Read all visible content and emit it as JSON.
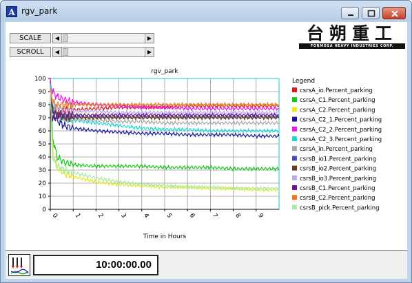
{
  "window": {
    "title": "rgv_park",
    "app_icon": "A"
  },
  "controls": {
    "scale_label": "SCALE",
    "scroll_label": "SCROLL"
  },
  "logo": {
    "chinese": "台朔重工",
    "english": "FORMOSA HEAVY INDUSTRIES CORP."
  },
  "status": {
    "time": "10:00:00.00",
    "icon": "recorder-pens-icon"
  },
  "chart_data": {
    "type": "line",
    "title": "rgv_park",
    "xlabel": "Time in Hours",
    "ylabel": "",
    "xlim": [
      0,
      10
    ],
    "ylim": [
      0,
      100
    ],
    "x_ticks": [
      "0",
      "1",
      "2",
      "3",
      "4",
      "5",
      "6",
      "7",
      "8",
      "9"
    ],
    "y_ticks": [
      "0",
      "10",
      "20",
      "30",
      "40",
      "50",
      "60",
      "70",
      "80",
      "90",
      "100"
    ],
    "grid": true,
    "legend_title": "Legend",
    "legend_position": "right",
    "series": [
      {
        "name": "csrsA_io.Percent_parking",
        "color": "#e01818",
        "x": [
          0,
          0.1,
          0.3,
          0.6,
          1,
          2,
          3,
          4,
          5,
          6,
          7,
          8,
          9,
          10
        ],
        "y": [
          92,
          80,
          74,
          76,
          76,
          77,
          78,
          78,
          78,
          79,
          79,
          79,
          79,
          79
        ]
      },
      {
        "name": "csrsA_C1.Percent_parking",
        "color": "#18c818",
        "x": [
          0,
          0.1,
          0.3,
          0.6,
          1,
          2,
          3,
          4,
          5,
          6,
          7,
          8,
          9,
          10
        ],
        "y": [
          95,
          55,
          40,
          36,
          34,
          33,
          33,
          33,
          32,
          32,
          32,
          31,
          31,
          31
        ]
      },
      {
        "name": "csrsA_C2.Percent_parking",
        "color": "#e8e818",
        "x": [
          0,
          0.1,
          0.3,
          0.6,
          1,
          2,
          3,
          4,
          5,
          6,
          7,
          8,
          9,
          10
        ],
        "y": [
          90,
          45,
          32,
          28,
          25,
          21,
          19,
          18,
          17,
          17,
          16,
          16,
          15,
          15
        ]
      },
      {
        "name": "csrsA_C2_1.Percent_parking",
        "color": "#1a1a9a",
        "x": [
          0,
          0.1,
          0.3,
          0.6,
          1,
          2,
          3,
          4,
          5,
          6,
          7,
          8,
          9,
          10
        ],
        "y": [
          90,
          75,
          68,
          64,
          62,
          60,
          59,
          58,
          58,
          57,
          57,
          57,
          56,
          56
        ]
      },
      {
        "name": "csrsA_C2_2.Percent_parking",
        "color": "#e818e8",
        "x": [
          0,
          0.1,
          0.3,
          0.6,
          1,
          2,
          3,
          4,
          5,
          6,
          7,
          8,
          9,
          10
        ],
        "y": [
          98,
          90,
          86,
          84,
          82,
          80,
          79,
          78,
          78,
          77,
          77,
          77,
          77,
          77
        ]
      },
      {
        "name": "csrsA_C2_3.Percent_parking",
        "color": "#18d8d8",
        "x": [
          0,
          0.1,
          0.3,
          0.6,
          1,
          2,
          3,
          4,
          5,
          6,
          7,
          8,
          9,
          10
        ],
        "y": [
          95,
          80,
          72,
          70,
          68,
          66,
          64,
          62,
          61,
          61,
          60,
          60,
          60,
          60
        ]
      },
      {
        "name": "csrsA_in.Percent_parking",
        "color": "#a8a8a8",
        "x": [
          0,
          0.1,
          0.3,
          0.6,
          1,
          2,
          3,
          4,
          5,
          6,
          7,
          8,
          9,
          10
        ],
        "y": [
          90,
          78,
          72,
          70,
          69,
          68,
          67,
          67,
          66,
          66,
          66,
          66,
          66,
          66
        ]
      },
      {
        "name": "csrsB_io1.Percent_parking",
        "color": "#4848b8",
        "x": [
          0,
          0.1,
          0.3,
          0.6,
          1,
          2,
          3,
          4,
          5,
          6,
          7,
          8,
          9,
          10
        ],
        "y": [
          85,
          75,
          72,
          71,
          71,
          71,
          71,
          71,
          71,
          71,
          71,
          71,
          71,
          71
        ]
      },
      {
        "name": "csrsB_io2.Percent_parking",
        "color": "#6b3a1a",
        "x": [
          0,
          0.1,
          0.3,
          0.6,
          1,
          2,
          3,
          4,
          5,
          6,
          7,
          8,
          9,
          10
        ],
        "y": [
          88,
          76,
          72,
          70,
          70,
          70,
          70,
          70,
          70,
          70,
          70,
          70,
          70,
          70
        ]
      },
      {
        "name": "csrsB_io3.Percent_parking",
        "color": "#b8a8e8",
        "x": [
          0,
          0.1,
          0.3,
          0.6,
          1,
          2,
          3,
          4,
          5,
          6,
          7,
          8,
          9,
          10
        ],
        "y": [
          92,
          82,
          78,
          76,
          75,
          75,
          74,
          74,
          74,
          74,
          74,
          74,
          74,
          74
        ]
      },
      {
        "name": "csrsB_C1.Percent_parking",
        "color": "#6a1a8a",
        "x": [
          0,
          0.1,
          0.3,
          0.6,
          1,
          2,
          3,
          4,
          5,
          6,
          7,
          8,
          9,
          10
        ],
        "y": [
          85,
          68,
          72,
          72,
          72,
          72,
          72,
          72,
          72,
          72,
          72,
          72,
          72,
          72
        ]
      },
      {
        "name": "csrsB_C2.Percent_parking",
        "color": "#e87818",
        "x": [
          0,
          0.1,
          0.3,
          0.6,
          1,
          2,
          3,
          4,
          5,
          6,
          7,
          8,
          9,
          10
        ],
        "y": [
          92,
          82,
          80,
          80,
          80,
          80,
          80,
          80,
          80,
          80,
          80,
          80,
          80,
          80
        ]
      },
      {
        "name": "csrsB_pick.Percent_parking",
        "color": "#a8e8a8",
        "x": [
          0,
          0.1,
          0.3,
          0.6,
          1,
          2,
          3,
          4,
          5,
          6,
          7,
          8,
          9,
          10
        ],
        "y": [
          88,
          40,
          33,
          30,
          28,
          24,
          21,
          19,
          18,
          17,
          17,
          16,
          16,
          16
        ]
      }
    ]
  }
}
